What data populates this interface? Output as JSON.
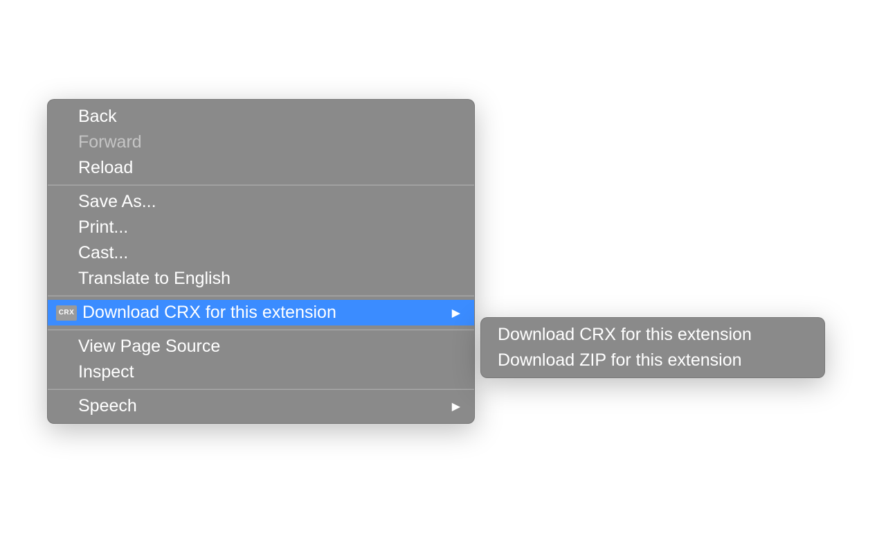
{
  "mainMenu": {
    "groups": [
      [
        {
          "label": "Back",
          "disabled": false,
          "hasSubmenu": false
        },
        {
          "label": "Forward",
          "disabled": true,
          "hasSubmenu": false
        },
        {
          "label": "Reload",
          "disabled": false,
          "hasSubmenu": false
        }
      ],
      [
        {
          "label": "Save As...",
          "disabled": false,
          "hasSubmenu": false
        },
        {
          "label": "Print...",
          "disabled": false,
          "hasSubmenu": false
        },
        {
          "label": "Cast...",
          "disabled": false,
          "hasSubmenu": false
        },
        {
          "label": "Translate to English",
          "disabled": false,
          "hasSubmenu": false
        }
      ],
      [
        {
          "label": "Download CRX for this extension",
          "disabled": false,
          "hasSubmenu": true,
          "highlighted": true,
          "icon": "CRX"
        }
      ],
      [
        {
          "label": "View Page Source",
          "disabled": false,
          "hasSubmenu": false
        },
        {
          "label": "Inspect",
          "disabled": false,
          "hasSubmenu": false
        }
      ],
      [
        {
          "label": "Speech",
          "disabled": false,
          "hasSubmenu": true
        }
      ]
    ]
  },
  "submenu": {
    "items": [
      {
        "label": "Download CRX for this extension"
      },
      {
        "label": "Download ZIP for this extension"
      }
    ]
  }
}
